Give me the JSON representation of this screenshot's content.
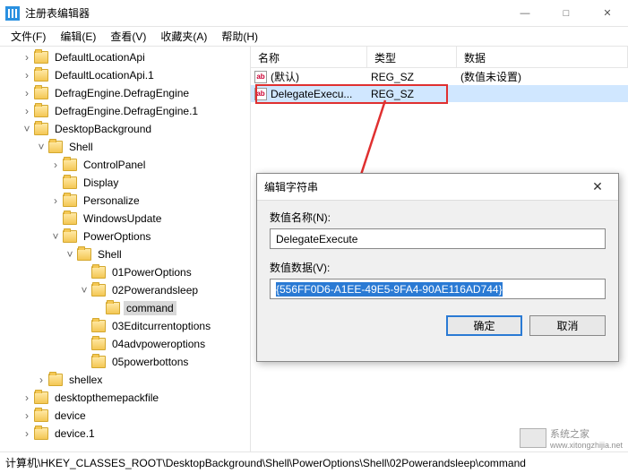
{
  "window": {
    "title": "注册表编辑器"
  },
  "menus": [
    "文件(F)",
    "编辑(E)",
    "查看(V)",
    "收藏夹(A)",
    "帮助(H)"
  ],
  "tree": [
    {
      "indent": 1,
      "toggle": ">",
      "label": "DefaultLocationApi"
    },
    {
      "indent": 1,
      "toggle": ">",
      "label": "DefaultLocationApi.1"
    },
    {
      "indent": 1,
      "toggle": ">",
      "label": "DefragEngine.DefragEngine"
    },
    {
      "indent": 1,
      "toggle": ">",
      "label": "DefragEngine.DefragEngine.1"
    },
    {
      "indent": 1,
      "toggle": "v",
      "label": "DesktopBackground"
    },
    {
      "indent": 2,
      "toggle": "v",
      "label": "Shell"
    },
    {
      "indent": 3,
      "toggle": ">",
      "label": "ControlPanel"
    },
    {
      "indent": 3,
      "toggle": "",
      "label": "Display"
    },
    {
      "indent": 3,
      "toggle": ">",
      "label": "Personalize"
    },
    {
      "indent": 3,
      "toggle": "",
      "label": "WindowsUpdate"
    },
    {
      "indent": 3,
      "toggle": "v",
      "label": "PowerOptions"
    },
    {
      "indent": 4,
      "toggle": "v",
      "label": "Shell"
    },
    {
      "indent": 5,
      "toggle": "",
      "label": "01PowerOptions"
    },
    {
      "indent": 5,
      "toggle": "v",
      "label": "02Powerandsleep"
    },
    {
      "indent": 6,
      "toggle": "",
      "label": "command",
      "selected": true
    },
    {
      "indent": 5,
      "toggle": "",
      "label": "03Editcurrentoptions"
    },
    {
      "indent": 5,
      "toggle": "",
      "label": "04advpoweroptions"
    },
    {
      "indent": 5,
      "toggle": "",
      "label": "05powerbottons"
    },
    {
      "indent": 2,
      "toggle": ">",
      "label": "shellex"
    },
    {
      "indent": 1,
      "toggle": ">",
      "label": "desktopthemepackfile"
    },
    {
      "indent": 1,
      "toggle": ">",
      "label": "device"
    },
    {
      "indent": 1,
      "toggle": ">",
      "label": "device.1"
    }
  ],
  "list": {
    "cols": {
      "name": "名称",
      "type": "类型",
      "data": "数据"
    },
    "rows": [
      {
        "name": "(默认)",
        "type": "REG_SZ",
        "data": "(数值未设置)"
      },
      {
        "name": "DelegateExecu...",
        "type": "REG_SZ",
        "data": "",
        "selected": true
      }
    ]
  },
  "dialog": {
    "title": "编辑字符串",
    "name_label": "数值名称(N):",
    "name_value": "DelegateExecute",
    "data_label": "数值数据(V):",
    "data_value": "{556FF0D6-A1EE-49E5-9FA4-90AE116AD744}",
    "ok": "确定",
    "cancel": "取消"
  },
  "status": "计算机\\HKEY_CLASSES_ROOT\\DesktopBackground\\Shell\\PowerOptions\\Shell\\02Powerandsleep\\command",
  "watermark": {
    "text": "系统之家",
    "url": "www.xitongzhijia.net"
  }
}
